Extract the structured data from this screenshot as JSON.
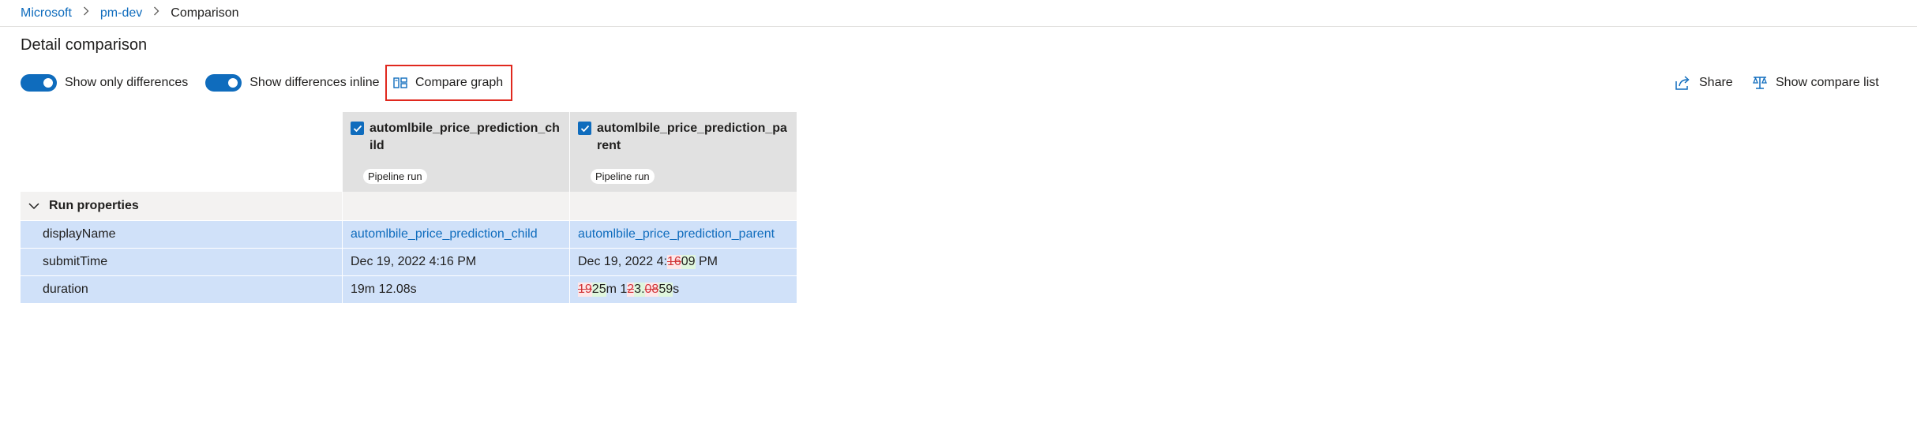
{
  "breadcrumb": {
    "items": [
      "Microsoft",
      "pm-dev"
    ],
    "current": "Comparison"
  },
  "page": {
    "title": "Detail comparison"
  },
  "toolbar": {
    "toggle_only_differences": {
      "label": "Show only differences",
      "on": true
    },
    "toggle_inline_differences": {
      "label": "Show differences inline",
      "on": true
    },
    "compare_graph_label": "Compare graph",
    "share_label": "Share",
    "show_compare_list_label": "Show compare list"
  },
  "columns": [
    {
      "name": "automlbile_price_prediction_child",
      "badge": "Pipeline run",
      "checked": true
    },
    {
      "name": "automlbile_price_prediction_parent",
      "badge": "Pipeline run",
      "checked": true
    }
  ],
  "section": {
    "label": "Run properties",
    "expanded": true
  },
  "rows": [
    {
      "key": "displayName",
      "col1": "automlbile_price_prediction_child",
      "col2": "automlbile_price_prediction_parent"
    },
    {
      "key": "submitTime",
      "col1": "Dec 19, 2022 4:16 PM",
      "col2_parts": {
        "prefix": "Dec 19, 2022 4:",
        "del": "16",
        "ins": "09",
        "suffix": " PM"
      }
    },
    {
      "key": "duration",
      "col1": "19m 12.08s",
      "col2_parts": {
        "del1": "19",
        "ins1": "25",
        "mid1": "m 1",
        "del2": "2",
        "ins2": "3.",
        "del3": "08",
        "ins3": "59",
        "suffix": "s"
      }
    }
  ],
  "colors": {
    "accent": "#0f6cbd",
    "highlight_border": "#e0281e",
    "row_highlight": "#d0e1f9"
  }
}
